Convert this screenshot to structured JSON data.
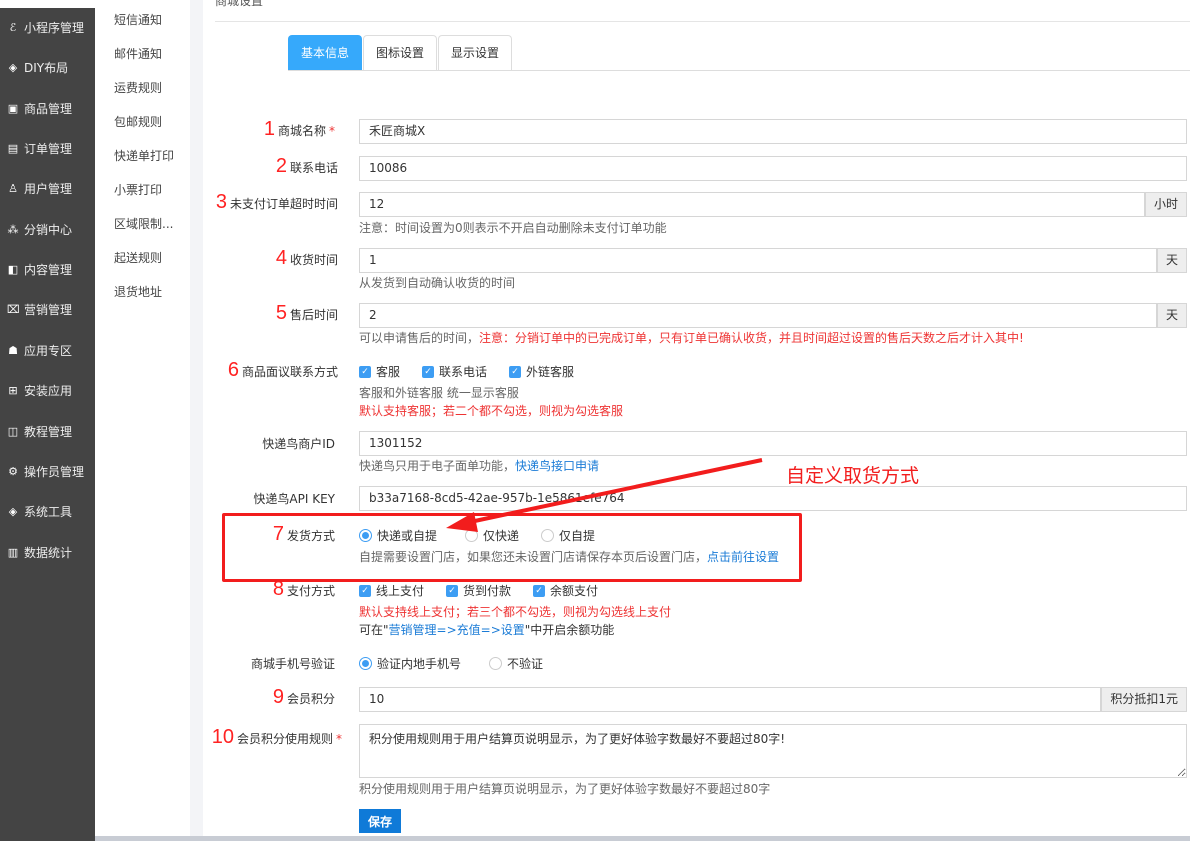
{
  "sidebar": {
    "items": [
      {
        "label": "小程序管理",
        "icon": "link-icon"
      },
      {
        "label": "DIY布局",
        "icon": "diamond-icon"
      },
      {
        "label": "商品管理",
        "icon": "bag-icon"
      },
      {
        "label": "订单管理",
        "icon": "clipboard-icon"
      },
      {
        "label": "用户管理",
        "icon": "user-icon"
      },
      {
        "label": "分销中心",
        "icon": "network-icon"
      },
      {
        "label": "内容管理",
        "icon": "content-icon"
      },
      {
        "label": "营销管理",
        "icon": "ticket-icon"
      },
      {
        "label": "应用专区",
        "icon": "app-icon"
      },
      {
        "label": "安装应用",
        "icon": "grid-icon"
      },
      {
        "label": "教程管理",
        "icon": "book-icon"
      },
      {
        "label": "操作员管理",
        "icon": "gear-icon"
      },
      {
        "label": "系统工具",
        "icon": "tool-icon"
      },
      {
        "label": "数据统计",
        "icon": "bar-chart-icon"
      }
    ]
  },
  "submenu": {
    "items": [
      "短信通知",
      "邮件通知",
      "运费规则",
      "包邮规则",
      "快递单打印",
      "小票打印",
      "区域限制...",
      "起送规则",
      "退货地址"
    ]
  },
  "page": {
    "title": "商城设置"
  },
  "tabs": [
    "基本信息",
    "图标设置",
    "显示设置"
  ],
  "form": {
    "name": {
      "num": "1",
      "label": "商城名称",
      "value": "禾匠商城X"
    },
    "phone": {
      "num": "2",
      "label": "联系电话",
      "value": "10086"
    },
    "timeout": {
      "num": "3",
      "label": "未支付订单超时时间",
      "value": "12",
      "suffix": "小时",
      "hint": "注意：时间设置为0则表示不开启自动删除未支付订单功能"
    },
    "receive": {
      "num": "4",
      "label": "收货时间",
      "value": "1",
      "suffix": "天",
      "hint": "从发货到自动确认收货的时间"
    },
    "aftersale": {
      "num": "5",
      "label": "售后时间",
      "value": "2",
      "suffix": "天",
      "hint": "可以申请售后的时间，",
      "hint_red": "注意：分销订单中的已完成订单，只有订单已确认收货，并且时间超过设置的售后天数之后才计入其中!"
    },
    "contact": {
      "num": "6",
      "label": "商品面议联系方式",
      "options": [
        "客服",
        "联系电话",
        "外链客服"
      ],
      "hint": "客服和外链客服 统一显示客服",
      "hint_red": "默认支持客服；若二个都不勾选，则视为勾选客服"
    },
    "kdn_id": {
      "label": "快递鸟商户ID",
      "value": "1301152",
      "hint": "快递鸟只用于电子面单功能，",
      "link": "快递鸟接口申请"
    },
    "kdn_key": {
      "label": "快递鸟API KEY",
      "value": "b33a7168-8cd5-42ae-957b-1e5861efe764"
    },
    "delivery": {
      "num": "7",
      "label": "发货方式",
      "options": [
        "快递或自提",
        "仅快递",
        "仅自提"
      ],
      "selected": 0,
      "hint": "自提需要设置门店，如果您还未设置门店请保存本页后设置门店，",
      "link": "点击前往设置"
    },
    "payment": {
      "num": "8",
      "label": "支付方式",
      "options": [
        "线上支付",
        "货到付款",
        "余额支付"
      ],
      "hint_red": "默认支持线上支付；若三个都不勾选，则视为勾选线上支付",
      "hint_a": "可在\"",
      "hint_link": "营销管理=>充值=>设置",
      "hint_b": "\"中开启余额功能"
    },
    "mobile_verify": {
      "label": "商城手机号验证",
      "options": [
        "验证内地手机号",
        "不验证"
      ],
      "selected": 0
    },
    "points": {
      "num": "9",
      "label": "会员积分",
      "value": "10",
      "suffix": "积分抵扣1元"
    },
    "points_rule": {
      "num": "10",
      "label": "会员积分使用规则",
      "value": "积分使用规则用于用户结算页说明显示，为了更好体验字数最好不要超过80字!",
      "hint": "积分使用规则用于用户结算页说明显示，为了更好体验字数最好不要超过80字"
    },
    "save_label": "保存"
  },
  "annotation": {
    "text": "自定义取货方式",
    "color": "#f21d1d"
  }
}
